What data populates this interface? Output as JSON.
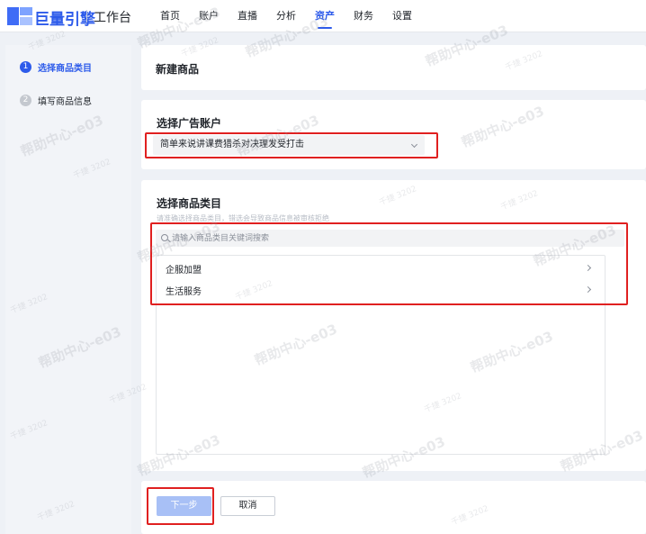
{
  "header": {
    "brand": "巨量引擎",
    "workspace": "工作台",
    "nav": [
      {
        "label": "首页",
        "active": false
      },
      {
        "label": "账户",
        "active": false
      },
      {
        "label": "直播",
        "active": false
      },
      {
        "label": "分析",
        "active": false
      },
      {
        "label": "资产",
        "active": true
      },
      {
        "label": "财务",
        "active": false
      },
      {
        "label": "设置",
        "active": false
      }
    ]
  },
  "steps": [
    {
      "num": "1",
      "label": "选择商品类目",
      "active": true
    },
    {
      "num": "2",
      "label": "填写商品信息",
      "active": false
    }
  ],
  "page": {
    "title": "新建商品"
  },
  "ad_account": {
    "title": "选择广告账户",
    "selected": "简单来说讲课费猎杀对决理发受打击"
  },
  "category": {
    "title": "选择商品类目",
    "hint": "请准确选择商品类目，错选会导致商品信息被审核拒绝",
    "search_placeholder": "请输入商品类目关键词搜索",
    "items": [
      {
        "label": "企服加盟"
      },
      {
        "label": "生活服务"
      }
    ]
  },
  "actions": {
    "next_label": "下一步",
    "cancel_label": "取消"
  },
  "watermark": {
    "big": "帮助中心-e03",
    "small": "千捷 3202"
  },
  "colors": {
    "accent": "#2d5bea",
    "annotation": "#e02020",
    "next_disabled": "#a8c0f6"
  }
}
